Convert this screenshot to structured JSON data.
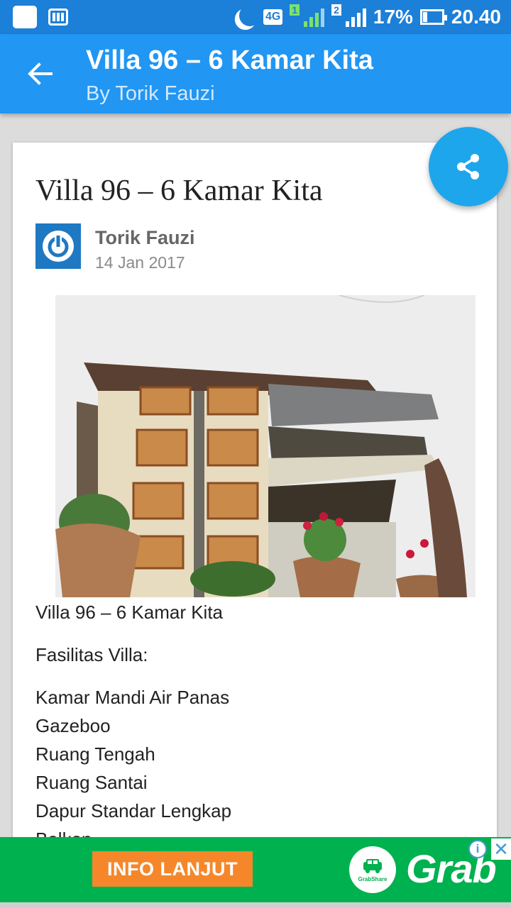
{
  "status_bar": {
    "battery": "17%",
    "time": "20.40",
    "network": "4G",
    "sim1": "1",
    "sim2": "2"
  },
  "app_bar": {
    "title": "Villa 96 – 6 Kamar Kita",
    "subtitle": "By Torik Fauzi"
  },
  "post": {
    "title": "Villa 96 – 6 Kamar Kita",
    "author": "Torik Fauzi",
    "date": "14 Jan 2017",
    "caption": "Villa 96 – 6 Kamar Kita",
    "facilities_heading": "Fasilitas Villa:",
    "facilities": [
      "Kamar Mandi Air Panas",
      "Gazeboo",
      "Ruang Tengah",
      "Ruang Santai",
      "Dapur Standar Lengkap",
      "Balkon"
    ]
  },
  "ad": {
    "button_label": "INFO LANJUT",
    "brand": "Grab",
    "logo_caption": "GrabShare",
    "info_label": "i",
    "close_label": "✕"
  },
  "colors": {
    "status_bar": "#1c7fd8",
    "app_bar": "#2196f3",
    "fab": "#1ea6ec",
    "ad_green": "#00b14f",
    "ad_button": "#f5872a"
  },
  "icons": {
    "back": "arrow-left-icon",
    "share": "share-icon",
    "avatar": "power-icon"
  }
}
